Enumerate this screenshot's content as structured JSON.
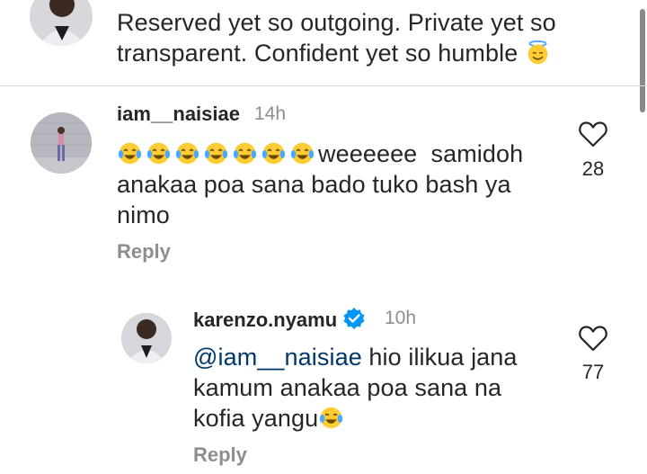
{
  "comments": [
    {
      "text_line1": "Reserved yet so outgoing. Private yet so",
      "text_line2": "transparent. Confident yet so humble"
    },
    {
      "username": "iam__naisiae",
      "time": "14h",
      "text_after_emoji": "weeeeee  samidoh",
      "text_line2": "anakaa poa sana bado tuko bash ya",
      "text_line3": "nimo",
      "likes": "28",
      "reply_label": "Reply"
    },
    {
      "username": "karenzo.nyamu",
      "time": "10h",
      "mention": "@iam__naisiae",
      "text_line1_rest": " hio ilikua jana",
      "text_line2": "kamum anakaa poa sana na",
      "text_line3": "kofia yangu",
      "likes": "77",
      "reply_label": "Reply"
    }
  ],
  "icons": {
    "like": "heart-outline-icon",
    "verified": "verified-badge-icon",
    "laughing": "tears-of-joy-emoji",
    "halo": "smiling-face-with-halo-emoji"
  },
  "colors": {
    "text": "#262626",
    "muted": "#8e8e8e",
    "mention": "#00376b",
    "verified": "#0095f6",
    "emoji": "#ffcc33"
  }
}
